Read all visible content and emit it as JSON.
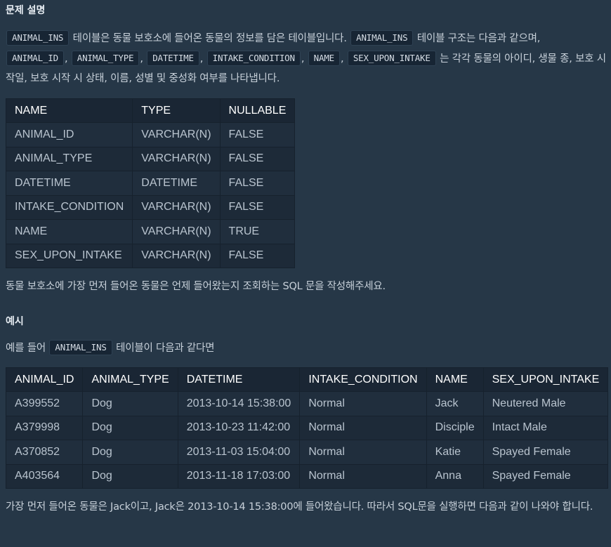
{
  "problem": {
    "heading": "문제 설명",
    "intro": {
      "code1": "ANIMAL_INS",
      "text1": " 테이블은 동물 보호소에 들어온 동물의 정보를 담은 테이블입니다. ",
      "code2": "ANIMAL_INS",
      "text2": " 테이블 구조는 다음과 같으며, ",
      "cols": [
        "ANIMAL_ID",
        "ANIMAL_TYPE",
        "DATETIME",
        "INTAKE_CONDITION",
        "NAME",
        "SEX_UPON_INTAKE"
      ],
      "sep": ", ",
      "text3": " 는 각각 동물의 아이디, 생물 종, 보호 시작일, 보호 시작 시 상태, 이름, 성별 및 중성화 여부를 나타냅니다."
    },
    "schema_table": {
      "headers": [
        "NAME",
        "TYPE",
        "NULLABLE"
      ],
      "rows": [
        [
          "ANIMAL_ID",
          "VARCHAR(N)",
          "FALSE"
        ],
        [
          "ANIMAL_TYPE",
          "VARCHAR(N)",
          "FALSE"
        ],
        [
          "DATETIME",
          "DATETIME",
          "FALSE"
        ],
        [
          "INTAKE_CONDITION",
          "VARCHAR(N)",
          "FALSE"
        ],
        [
          "NAME",
          "VARCHAR(N)",
          "TRUE"
        ],
        [
          "SEX_UPON_INTAKE",
          "VARCHAR(N)",
          "FALSE"
        ]
      ]
    },
    "task": "동물 보호소에 가장 먼저 들어온 동물은 언제 들어왔는지 조회하는 SQL 문을 작성해주세요."
  },
  "example": {
    "heading": "예시",
    "intro_before": "예를 들어 ",
    "intro_code": "ANIMAL_INS",
    "intro_after": " 테이블이 다음과 같다면",
    "table": {
      "headers": [
        "ANIMAL_ID",
        "ANIMAL_TYPE",
        "DATETIME",
        "INTAKE_CONDITION",
        "NAME",
        "SEX_UPON_INTAKE"
      ],
      "rows": [
        [
          "A399552",
          "Dog",
          "2013-10-14 15:38:00",
          "Normal",
          "Jack",
          "Neutered Male"
        ],
        [
          "A379998",
          "Dog",
          "2013-10-23 11:42:00",
          "Normal",
          "Disciple",
          "Intact Male"
        ],
        [
          "A370852",
          "Dog",
          "2013-11-03 15:04:00",
          "Normal",
          "Katie",
          "Spayed Female"
        ],
        [
          "A403564",
          "Dog",
          "2013-11-18 17:03:00",
          "Normal",
          "Anna",
          "Spayed Female"
        ]
      ]
    },
    "conclusion": "가장 먼저 들어온 동물은 Jack이고, Jack은 2013-10-14 15:38:00에 들어왔습니다. 따라서 SQL문을 실행하면 다음과 같이 나와야 합니다."
  }
}
